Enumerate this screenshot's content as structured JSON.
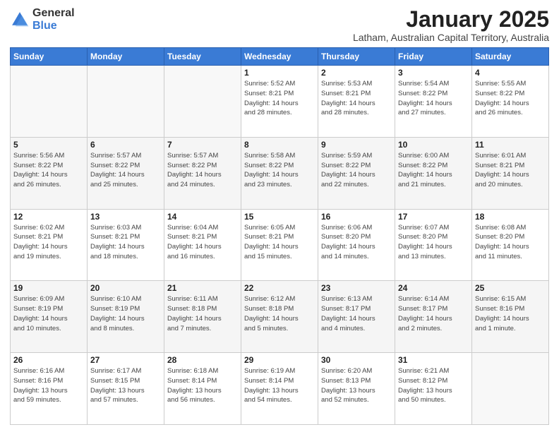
{
  "logo": {
    "general": "General",
    "blue": "Blue"
  },
  "header": {
    "month": "January 2025",
    "location": "Latham, Australian Capital Territory, Australia"
  },
  "days_of_week": [
    "Sunday",
    "Monday",
    "Tuesday",
    "Wednesday",
    "Thursday",
    "Friday",
    "Saturday"
  ],
  "weeks": [
    [
      {
        "day": "",
        "info": ""
      },
      {
        "day": "",
        "info": ""
      },
      {
        "day": "",
        "info": ""
      },
      {
        "day": "1",
        "info": "Sunrise: 5:52 AM\nSunset: 8:21 PM\nDaylight: 14 hours\nand 28 minutes."
      },
      {
        "day": "2",
        "info": "Sunrise: 5:53 AM\nSunset: 8:21 PM\nDaylight: 14 hours\nand 28 minutes."
      },
      {
        "day": "3",
        "info": "Sunrise: 5:54 AM\nSunset: 8:22 PM\nDaylight: 14 hours\nand 27 minutes."
      },
      {
        "day": "4",
        "info": "Sunrise: 5:55 AM\nSunset: 8:22 PM\nDaylight: 14 hours\nand 26 minutes."
      }
    ],
    [
      {
        "day": "5",
        "info": "Sunrise: 5:56 AM\nSunset: 8:22 PM\nDaylight: 14 hours\nand 26 minutes."
      },
      {
        "day": "6",
        "info": "Sunrise: 5:57 AM\nSunset: 8:22 PM\nDaylight: 14 hours\nand 25 minutes."
      },
      {
        "day": "7",
        "info": "Sunrise: 5:57 AM\nSunset: 8:22 PM\nDaylight: 14 hours\nand 24 minutes."
      },
      {
        "day": "8",
        "info": "Sunrise: 5:58 AM\nSunset: 8:22 PM\nDaylight: 14 hours\nand 23 minutes."
      },
      {
        "day": "9",
        "info": "Sunrise: 5:59 AM\nSunset: 8:22 PM\nDaylight: 14 hours\nand 22 minutes."
      },
      {
        "day": "10",
        "info": "Sunrise: 6:00 AM\nSunset: 8:22 PM\nDaylight: 14 hours\nand 21 minutes."
      },
      {
        "day": "11",
        "info": "Sunrise: 6:01 AM\nSunset: 8:21 PM\nDaylight: 14 hours\nand 20 minutes."
      }
    ],
    [
      {
        "day": "12",
        "info": "Sunrise: 6:02 AM\nSunset: 8:21 PM\nDaylight: 14 hours\nand 19 minutes."
      },
      {
        "day": "13",
        "info": "Sunrise: 6:03 AM\nSunset: 8:21 PM\nDaylight: 14 hours\nand 18 minutes."
      },
      {
        "day": "14",
        "info": "Sunrise: 6:04 AM\nSunset: 8:21 PM\nDaylight: 14 hours\nand 16 minutes."
      },
      {
        "day": "15",
        "info": "Sunrise: 6:05 AM\nSunset: 8:21 PM\nDaylight: 14 hours\nand 15 minutes."
      },
      {
        "day": "16",
        "info": "Sunrise: 6:06 AM\nSunset: 8:20 PM\nDaylight: 14 hours\nand 14 minutes."
      },
      {
        "day": "17",
        "info": "Sunrise: 6:07 AM\nSunset: 8:20 PM\nDaylight: 14 hours\nand 13 minutes."
      },
      {
        "day": "18",
        "info": "Sunrise: 6:08 AM\nSunset: 8:20 PM\nDaylight: 14 hours\nand 11 minutes."
      }
    ],
    [
      {
        "day": "19",
        "info": "Sunrise: 6:09 AM\nSunset: 8:19 PM\nDaylight: 14 hours\nand 10 minutes."
      },
      {
        "day": "20",
        "info": "Sunrise: 6:10 AM\nSunset: 8:19 PM\nDaylight: 14 hours\nand 8 minutes."
      },
      {
        "day": "21",
        "info": "Sunrise: 6:11 AM\nSunset: 8:18 PM\nDaylight: 14 hours\nand 7 minutes."
      },
      {
        "day": "22",
        "info": "Sunrise: 6:12 AM\nSunset: 8:18 PM\nDaylight: 14 hours\nand 5 minutes."
      },
      {
        "day": "23",
        "info": "Sunrise: 6:13 AM\nSunset: 8:17 PM\nDaylight: 14 hours\nand 4 minutes."
      },
      {
        "day": "24",
        "info": "Sunrise: 6:14 AM\nSunset: 8:17 PM\nDaylight: 14 hours\nand 2 minutes."
      },
      {
        "day": "25",
        "info": "Sunrise: 6:15 AM\nSunset: 8:16 PM\nDaylight: 14 hours\nand 1 minute."
      }
    ],
    [
      {
        "day": "26",
        "info": "Sunrise: 6:16 AM\nSunset: 8:16 PM\nDaylight: 13 hours\nand 59 minutes."
      },
      {
        "day": "27",
        "info": "Sunrise: 6:17 AM\nSunset: 8:15 PM\nDaylight: 13 hours\nand 57 minutes."
      },
      {
        "day": "28",
        "info": "Sunrise: 6:18 AM\nSunset: 8:14 PM\nDaylight: 13 hours\nand 56 minutes."
      },
      {
        "day": "29",
        "info": "Sunrise: 6:19 AM\nSunset: 8:14 PM\nDaylight: 13 hours\nand 54 minutes."
      },
      {
        "day": "30",
        "info": "Sunrise: 6:20 AM\nSunset: 8:13 PM\nDaylight: 13 hours\nand 52 minutes."
      },
      {
        "day": "31",
        "info": "Sunrise: 6:21 AM\nSunset: 8:12 PM\nDaylight: 13 hours\nand 50 minutes."
      },
      {
        "day": "",
        "info": ""
      }
    ]
  ]
}
